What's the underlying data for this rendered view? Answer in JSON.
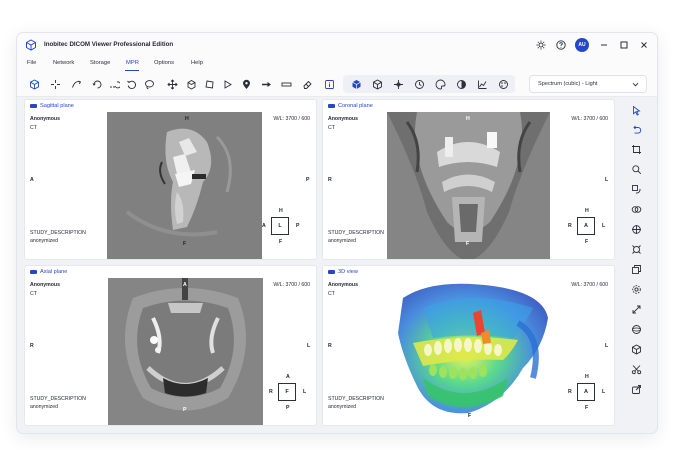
{
  "app": {
    "title": "Inobitec DICOM Viewer Professional Edition",
    "user_initials": "AU"
  },
  "menu": [
    "File",
    "Network",
    "Storage",
    "MPR",
    "Options",
    "Help"
  ],
  "menu_active": "MPR",
  "toolbar": {
    "lut_value": "Spectrum (cubic) - Light"
  },
  "viewports": {
    "sagittal": {
      "title": "Sagittal plane",
      "patient": "Anonymous",
      "modality": "CT",
      "wl": "W/L: 3700 / 600",
      "study": "STUDY_DESCRIPTION",
      "anon": "anonymized",
      "edge_top": "H",
      "edge_left": "A",
      "edge_right": "P",
      "edge_bottom": "F",
      "cube": {
        "top": "H",
        "left": "A",
        "center": "L",
        "right": "P",
        "bottom": "F"
      }
    },
    "coronal": {
      "title": "Coronal plane",
      "patient": "Anonymous",
      "modality": "CT",
      "wl": "W/L: 3700 / 600",
      "study": "STUDY_DESCRIPTION",
      "anon": "anonymized",
      "edge_top": "H",
      "edge_left": "R",
      "edge_right": "L",
      "edge_bottom": "F",
      "cube": {
        "top": "H",
        "left": "R",
        "center": "A",
        "right": "L",
        "bottom": "F"
      }
    },
    "axial": {
      "title": "Axial plane",
      "patient": "Anonymous",
      "modality": "CT",
      "wl": "W/L: 3700 / 600",
      "study": "STUDY_DESCRIPTION",
      "anon": "anonymized",
      "edge_top": "A",
      "edge_left": "R",
      "edge_right": "L",
      "edge_bottom": "P",
      "cube": {
        "top": "A",
        "left": "R",
        "center": "F",
        "right": "L",
        "bottom": "P"
      }
    },
    "view3d": {
      "title": "3D view",
      "patient": "Anonymous",
      "modality": "CT",
      "wl": "W/L: 3700 / 600",
      "study": "STUDY_DESCRIPTION",
      "anon": "anonymized",
      "edge_left": "R",
      "edge_right": "L",
      "edge_bottom": "F",
      "cube": {
        "top": "H",
        "left": "R",
        "center": "A",
        "right": "L",
        "bottom": "F"
      }
    }
  },
  "colors": {
    "accent": "#2747c9",
    "panel_bg": "#ffffff",
    "app_bg": "#f1f2f5"
  },
  "icons": {
    "title_bar": [
      "settings-sun-icon",
      "help-icon",
      "avatar",
      "minimize-icon",
      "maximize-icon",
      "close-icon"
    ],
    "sidebar": [
      "pointer-icon",
      "undo-icon",
      "crop-icon",
      "zoom-area-icon",
      "rotate-roi-icon",
      "merge-icon",
      "crosshair-icon",
      "target-icon",
      "layers-icon",
      "gear-icon",
      "expand-icon",
      "sphere-icon",
      "cube-icon",
      "scissors-icon",
      "export-icon"
    ]
  }
}
